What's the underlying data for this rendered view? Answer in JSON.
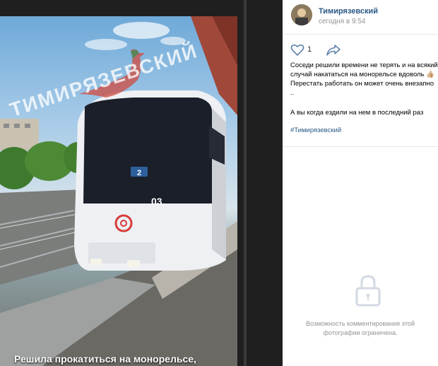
{
  "post": {
    "author": "Тимирязевский",
    "time": "сегодня в 9:54",
    "likes": "1",
    "text": "Соседи решили времени не терять и на всякий случай накататься на монорельсе вдоволь 👍🏼 Перестать работать он может очень внезапно ..",
    "text2": "А вы когда ездили на нем в последний раз",
    "hashtag": "#Тимирязевский",
    "comments_restricted": "Возможность комментирования этой фотографии ограничена."
  },
  "photo": {
    "watermark": "ТИМИРЯЗЕВСКИЙ",
    "caption": "Решила прокатиться на монорельсе,",
    "train_number": "03",
    "route_number": "2"
  },
  "colors": {
    "link": "#2a5885",
    "muted": "#939393",
    "viewer_bg": "#1f1f1f"
  }
}
